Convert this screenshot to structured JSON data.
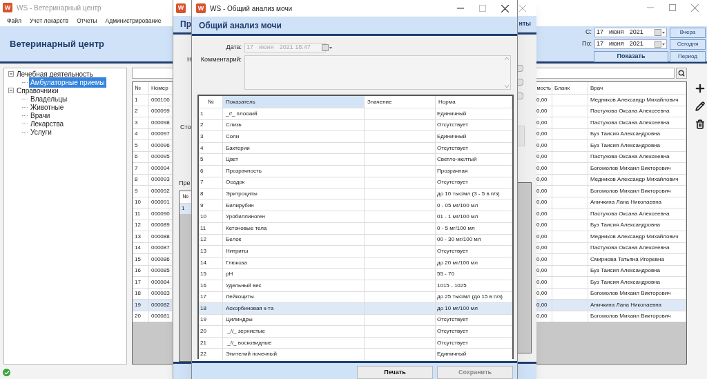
{
  "main_window": {
    "icon_letter": "W",
    "title": "WS - Ветеринарный центр",
    "menu": [
      "Файл",
      "Учет лекарств",
      "Отчеты",
      "Администрирование"
    ],
    "header_title": "Ветеринарный центр",
    "period": {
      "from_label": "С:",
      "from_date": [
        "17",
        "июня",
        "2021"
      ],
      "to_label": "По:",
      "to_date": [
        "17",
        "июня",
        "2021"
      ],
      "day_buttons": [
        "Вчера",
        "Сегодня"
      ],
      "show_button": "Показать",
      "period_button": "Период"
    }
  },
  "tree": [
    {
      "label": "Лечебная деятельность",
      "expanded": true,
      "selected": false,
      "children": [
        {
          "label": "Амбулаторные приемы",
          "selected": true
        }
      ]
    },
    {
      "label": "Справочники",
      "expanded": true,
      "selected": false,
      "children": [
        {
          "label": "Владельцы",
          "selected": false
        },
        {
          "label": "Животные",
          "selected": false
        },
        {
          "label": "Врачи",
          "selected": false
        },
        {
          "label": "Лекарства",
          "selected": false
        },
        {
          "label": "Услуги",
          "selected": false
        }
      ]
    }
  ],
  "visits_table": {
    "columns": [
      "№",
      "Номер",
      "мость",
      "Бланк",
      "Врач"
    ],
    "rows": [
      {
        "cells": [
          "1",
          "000100",
          "0,00",
          "Медников  Александр  Михайлович"
        ],
        "selected": false
      },
      {
        "cells": [
          "2",
          "000099",
          "0,00",
          "Пастухова  Оксана Алексеевна"
        ],
        "selected": false
      },
      {
        "cells": [
          "3",
          "000098",
          "0,00",
          "Пастухова  Оксана Алексеевна"
        ],
        "selected": false
      },
      {
        "cells": [
          "4",
          "000097",
          "0,00",
          "Буз  Таисия  Александровна"
        ],
        "selected": false
      },
      {
        "cells": [
          "5",
          "000096",
          "0,00",
          "Буз  Таисия  Александровна"
        ],
        "selected": false
      },
      {
        "cells": [
          "6",
          "000095",
          "0,00",
          "Пастухова  Оксана Алексеевна"
        ],
        "selected": false
      },
      {
        "cells": [
          "7",
          "000094",
          "0,00",
          "Богомолов Михаил Викторович"
        ],
        "selected": false
      },
      {
        "cells": [
          "8",
          "000093",
          "0,00",
          "Медников  Александр  Михайлович"
        ],
        "selected": false
      },
      {
        "cells": [
          "9",
          "000092",
          "0,00",
          "Богомолов Михаил Викторович"
        ],
        "selected": false
      },
      {
        "cells": [
          "10",
          "000091",
          "0,00",
          "Аничкина  Лана  Николаевна"
        ],
        "selected": false
      },
      {
        "cells": [
          "11",
          "000090",
          "0,00",
          "Пастухова  Оксана Алексеевна"
        ],
        "selected": false
      },
      {
        "cells": [
          "12",
          "000089",
          "0,00",
          "Буз  Таисия  Александровна"
        ],
        "selected": false
      },
      {
        "cells": [
          "13",
          "000088",
          "0,00",
          "Медников  Александр  Михайлович"
        ],
        "selected": false
      },
      {
        "cells": [
          "14",
          "000087",
          "0,00",
          "Пастухова  Оксана Алексеевна"
        ],
        "selected": false
      },
      {
        "cells": [
          "15",
          "000086",
          "0,00",
          "Смирнова  Татьяна  Игоревна"
        ],
        "selected": false
      },
      {
        "cells": [
          "16",
          "000085",
          "0,00",
          "Буз  Таисия  Александровна"
        ],
        "selected": false
      },
      {
        "cells": [
          "17",
          "000084",
          "0,00",
          "Буз  Таисия  Александровна"
        ],
        "selected": false
      },
      {
        "cells": [
          "18",
          "000083",
          "0,00",
          "Богомолов Михаил Викторович"
        ],
        "selected": false
      },
      {
        "cells": [
          "19",
          "000082",
          "0,00",
          "Аничкина  Лана  Николаевна"
        ],
        "selected": true
      },
      {
        "cells": [
          "20",
          "000081",
          "0,00",
          "Богомолов Михаил Викторович"
        ],
        "selected": false
      }
    ]
  },
  "middle_dialog": {
    "icon_letter": "W",
    "header_fragment": "Пр",
    "header_fragment_right": "нты",
    "label_fragments": [
      "Н",
      "Сто",
      "Пре"
    ],
    "subtable": {
      "column": "№",
      "rows": [
        {
          "cell": "1",
          "selected": true
        }
      ]
    }
  },
  "dialog": {
    "icon_letter": "W",
    "title": "WS - Общий анализ мочи",
    "header_title": "Общий анализ мочи",
    "date_label": "Дата:",
    "date": [
      "17",
      "июня",
      "2021 18:47"
    ],
    "date_disabled": true,
    "comment_label": "Комментарий:",
    "table": {
      "columns": [
        {
          "label": "№",
          "highlighted": false
        },
        {
          "label": "Показатель",
          "highlighted": true
        },
        {
          "label": "Значение",
          "highlighted": false
        },
        {
          "label": "Норма",
          "highlighted": false
        }
      ],
      "rows": [
        {
          "num": "1",
          "name": "_//_ плоский",
          "norm": "Единичный",
          "selected": false
        },
        {
          "num": "2",
          "name": "Слизь",
          "norm": "Отсутствует",
          "selected": false
        },
        {
          "num": "3",
          "name": "Соли",
          "norm": "Единичный",
          "selected": false
        },
        {
          "num": "4",
          "name": "Бактерии",
          "norm": "Отсутствует",
          "selected": false
        },
        {
          "num": "5",
          "name": "Цвет",
          "norm": "Светло-желтый",
          "selected": false
        },
        {
          "num": "6",
          "name": "Прозрачность",
          "norm": "Прозрачная",
          "selected": false
        },
        {
          "num": "7",
          "name": "Осадок",
          "norm": "Отсутствует",
          "selected": false
        },
        {
          "num": "8",
          "name": "Эритроциты",
          "norm": "до 10 тыс/мл (3 - 5 в п/з)",
          "selected": false
        },
        {
          "num": "9",
          "name": "Билирубин",
          "norm": "0 - 05 мг/100 мл",
          "selected": false
        },
        {
          "num": "10",
          "name": "Уробиллиноген",
          "norm": "01 - 1 мг/100 мл",
          "selected": false
        },
        {
          "num": "11",
          "name": "Кетоновые тела",
          "norm": "0 - 5 мг/100 мл",
          "selected": false
        },
        {
          "num": "12",
          "name": "Белок",
          "norm": "00 - 30 мг/100 мл",
          "selected": false
        },
        {
          "num": "13",
          "name": "Нитриты",
          "norm": "Отсутствует",
          "selected": false
        },
        {
          "num": "14",
          "name": "Глюкоза",
          "norm": "до 20 мг/100 мл",
          "selected": false
        },
        {
          "num": "15",
          "name": "pH",
          "norm": "55 - 70",
          "selected": false
        },
        {
          "num": "16",
          "name": "Удельный вес",
          "norm": "1015 - 1025",
          "selected": false
        },
        {
          "num": "17",
          "name": "Лейкоциты",
          "norm": "до 25 тыс/мл (до 15 в п/з)",
          "selected": false
        },
        {
          "num": "18",
          "name": "Аскорбиновая к-та",
          "norm": "до 10 мг/100 мл",
          "selected": true
        },
        {
          "num": "19",
          "name": "Цилиндры",
          "norm": "Отсутствует",
          "selected": false
        },
        {
          "num": "20",
          "name": " _//_ зернистые",
          "norm": "Отсутствует",
          "selected": false
        },
        {
          "num": "21",
          "name": " _//_ восковидные",
          "norm": "Отсутствует",
          "selected": false
        },
        {
          "num": "22",
          "name": "Эпителий почечный",
          "norm": "Единичный",
          "selected": false
        }
      ]
    },
    "buttons": [
      {
        "label": "Печать",
        "disabled": false
      },
      {
        "label": "Сохранить",
        "disabled": true
      }
    ]
  }
}
